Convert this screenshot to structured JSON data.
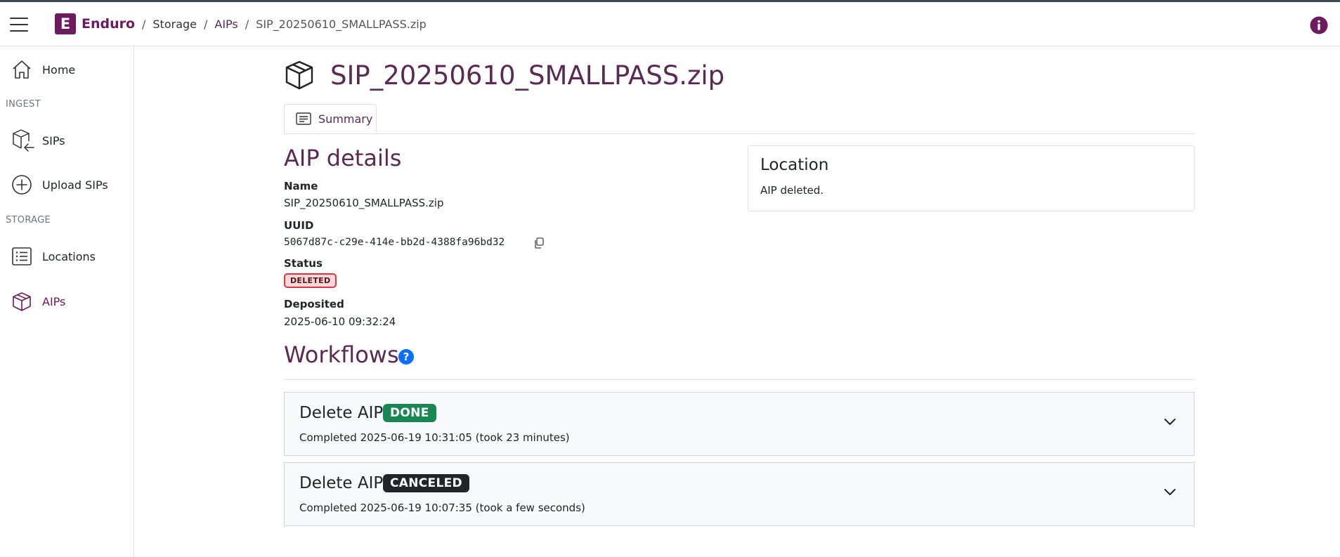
{
  "app": {
    "name": "Enduro",
    "logo_letter": "E",
    "brand_color": "#6d1a5f"
  },
  "breadcrumb": {
    "items": [
      "Storage",
      "AIPs",
      "SIP_20250610_SMALLPASS.zip"
    ],
    "separator": "/"
  },
  "sidebar": {
    "home": "Home",
    "ingest_section": "INGEST",
    "sips": "SIPs",
    "upload_sips": "Upload SIPs",
    "storage_section": "STORAGE",
    "locations": "Locations",
    "aips": "AIPs",
    "active": "AIPs"
  },
  "page": {
    "title": "SIP_20250610_SMALLPASS.zip",
    "tab_summary": "Summary"
  },
  "details": {
    "heading": "AIP details",
    "name_label": "Name",
    "name_value": "SIP_20250610_SMALLPASS.zip",
    "uuid_label": "UUID",
    "uuid_value": "5067d87c-c29e-414e-bb2d-4388fa96bd32",
    "status_label": "Status",
    "status_value": "DELETED",
    "deposited_label": "Deposited",
    "deposited_value": "2025-06-10 09:32:24"
  },
  "location": {
    "title": "Location",
    "text": "AIP deleted."
  },
  "workflows": {
    "heading": "Workflows",
    "items": [
      {
        "title": "Delete AIP",
        "badge": "DONE",
        "badge_color": "#198754",
        "subtitle": "Completed 2025-06-19 10:31:05 (took 23 minutes)"
      },
      {
        "title": "Delete AIP",
        "badge": "CANCELED",
        "badge_color": "#212529",
        "subtitle": "Completed 2025-06-19 10:07:35 (took a few seconds)"
      }
    ]
  },
  "icons": {
    "menu": "hamburger-icon",
    "info": "info-icon",
    "home": "home-icon",
    "sips": "package-in-icon",
    "upload": "plus-circle-icon",
    "locations": "list-icon",
    "aips": "box-icon",
    "copy": "copy-icon",
    "help": "question-icon",
    "expand": "chevron-down-icon"
  }
}
